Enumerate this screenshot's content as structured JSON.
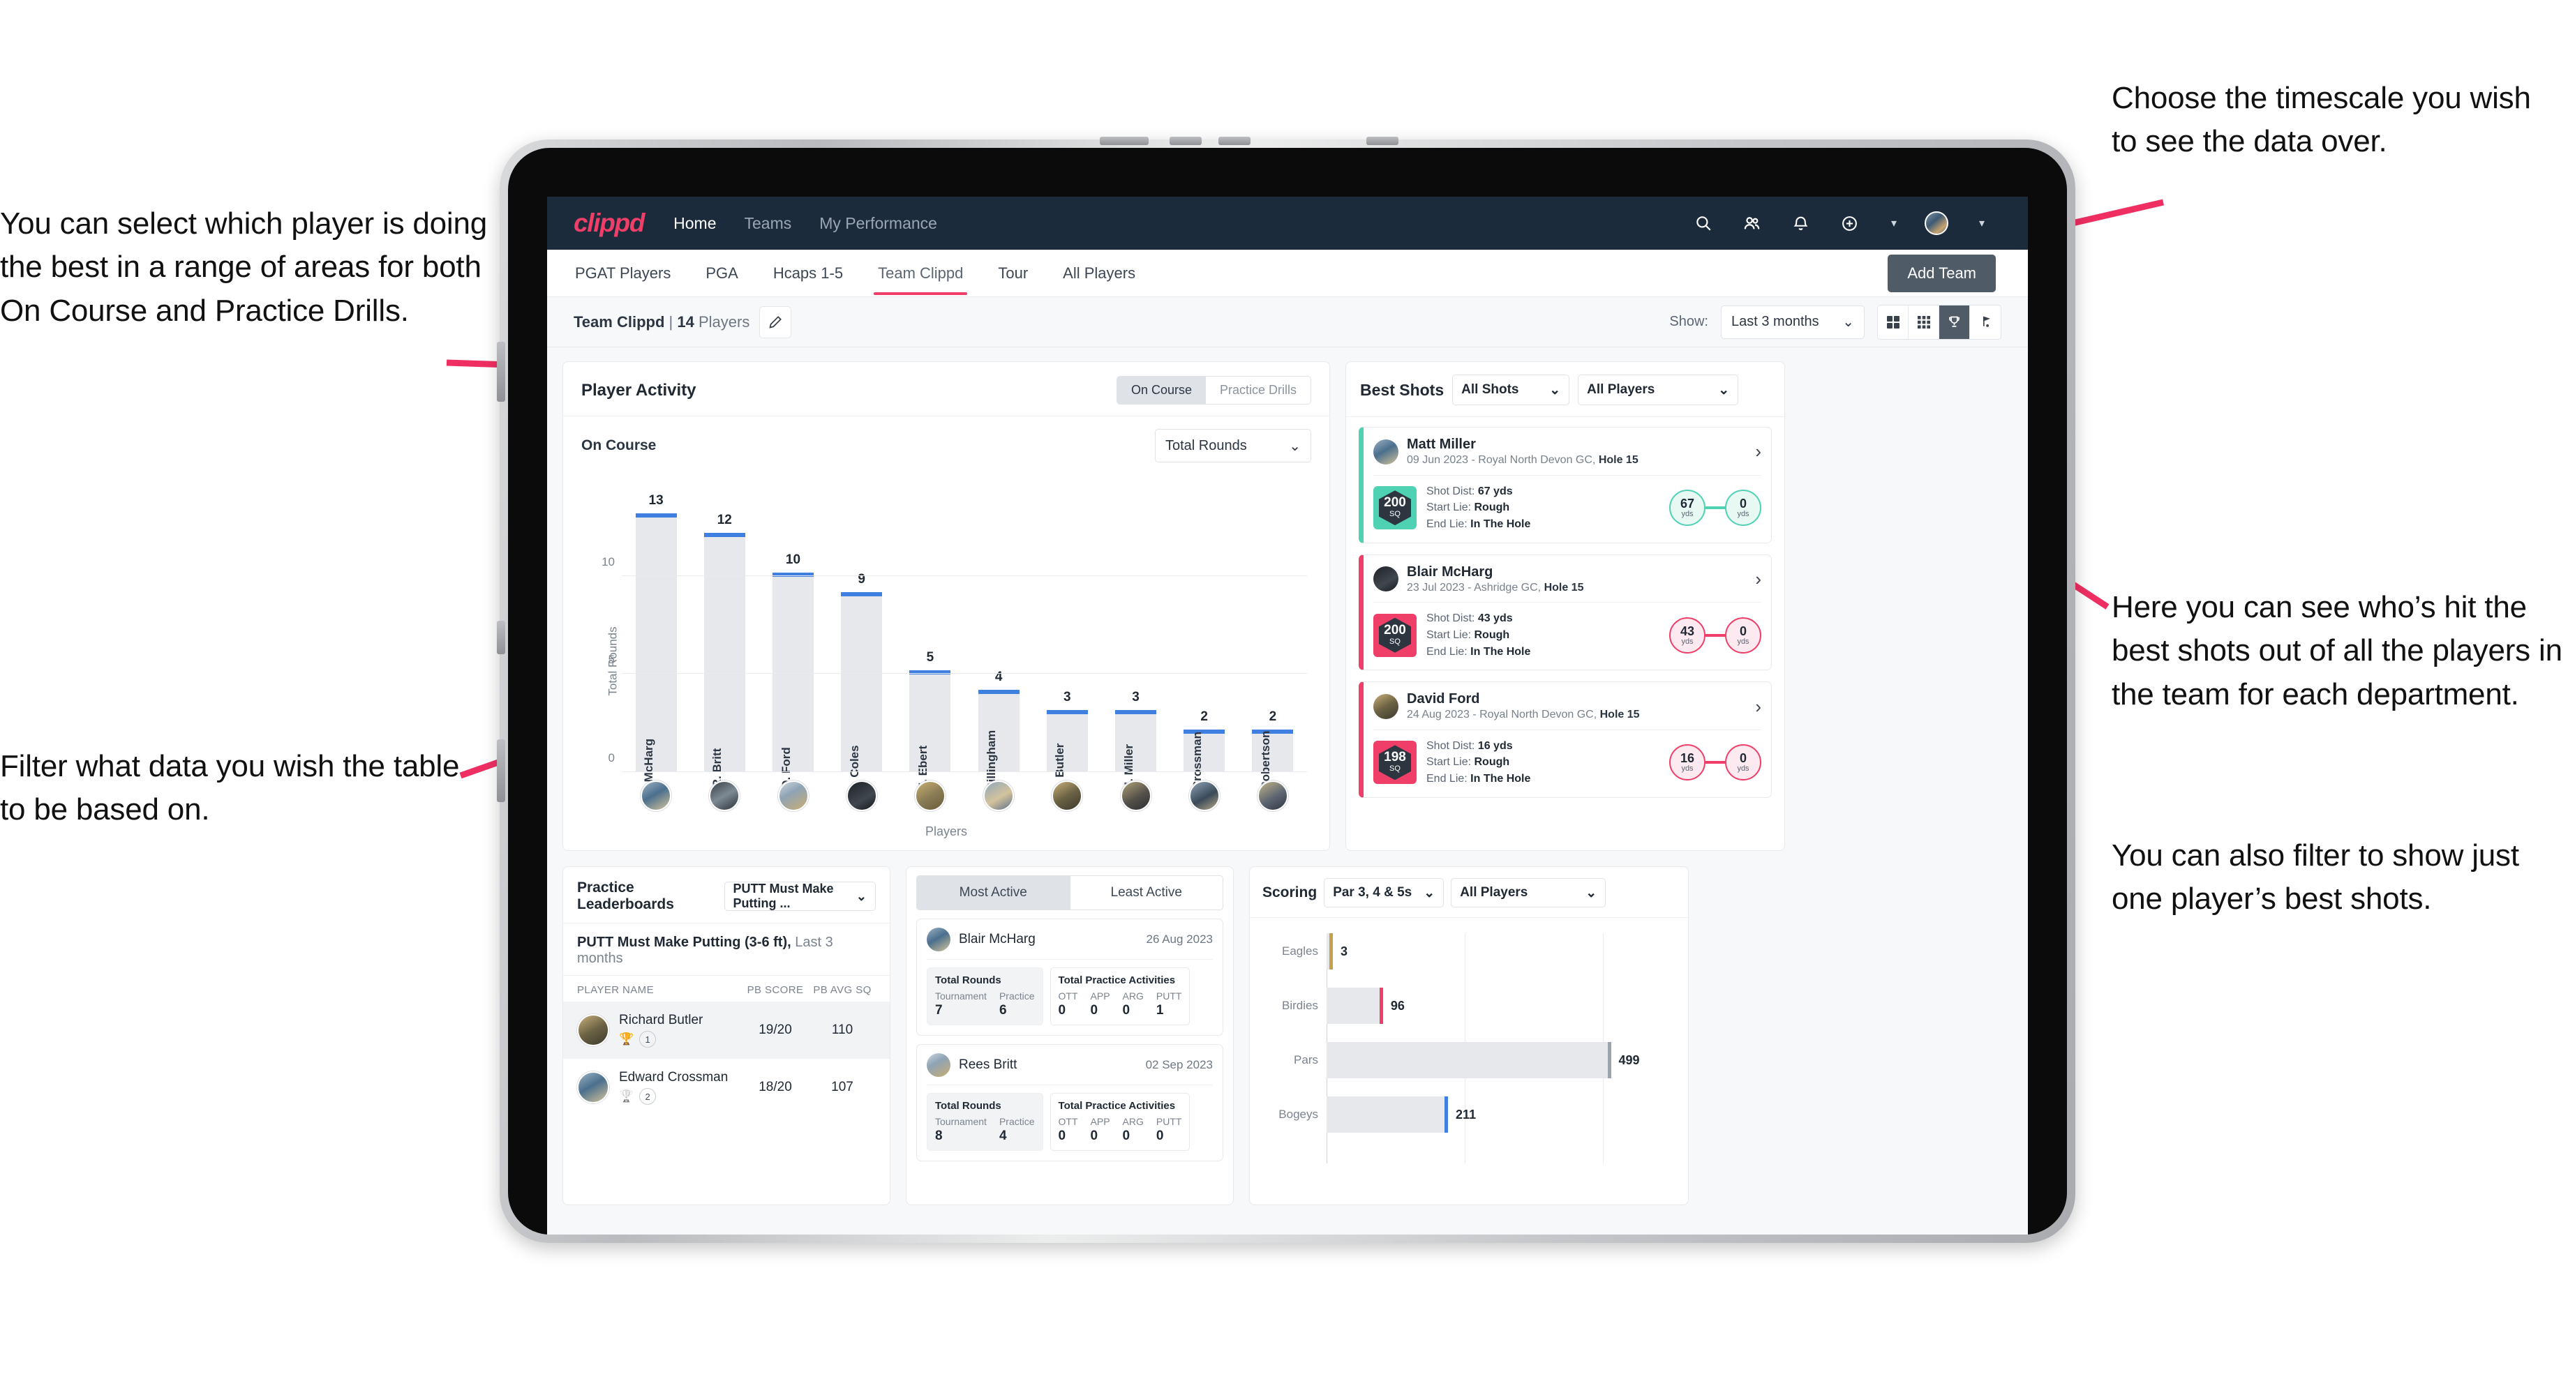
{
  "annotations": {
    "left_top": "You can select which player is doing the best in a range of areas for both On Course and Practice Drills.",
    "left_bottom": "Filter what data you wish the table to be based on.",
    "right_top": "Choose the timescale you wish to see the data over.",
    "right_mid": "Here you can see who’s hit the best shots out of all the players in the team for each department.",
    "right_bottom": "You can also filter to show just one player’s best shots."
  },
  "colors": {
    "brand_pink": "#ef3e68",
    "navbar": "#1b2b3b",
    "bar_blue": "#3f7fe0",
    "teal": "#4fd1b3",
    "gold": "#c4a14a",
    "arrow": "#ef2f62"
  },
  "navbar": {
    "logo": "clippd",
    "links": [
      {
        "label": "Home",
        "active": true
      },
      {
        "label": "Teams",
        "active": false
      },
      {
        "label": "My Performance",
        "active": false
      }
    ],
    "icons": [
      "search-icon",
      "people-icon",
      "bell-icon",
      "plus-circle-icon",
      "avatar"
    ]
  },
  "tabs": [
    {
      "label": "PGAT Players",
      "active": false
    },
    {
      "label": "PGA",
      "active": false
    },
    {
      "label": "Hcaps 1-5",
      "active": false
    },
    {
      "label": "Team Clippd",
      "active": true
    },
    {
      "label": "Tour",
      "active": false
    },
    {
      "label": "All Players",
      "active": false
    }
  ],
  "add_team_label": "Add Team",
  "subheader": {
    "team_name": "Team Clippd",
    "separator": "|",
    "player_count": "14",
    "players_word": "Players",
    "show_label": "Show:",
    "show_value": "Last 3 months",
    "view_buttons": [
      "grid-2x2-icon",
      "grid-3x3-icon",
      "trophy-icon",
      "golf-flag-icon"
    ],
    "active_view_index": 2
  },
  "player_activity": {
    "title": "Player Activity",
    "segments": [
      {
        "label": "On Course",
        "active": true
      },
      {
        "label": "Practice Drills",
        "active": false
      }
    ],
    "sub_title": "On Course",
    "metric_select": "Total Rounds"
  },
  "chart_data": [
    {
      "id": "player-activity",
      "type": "bar",
      "title": "Player Activity - On Course",
      "xlabel": "Players",
      "ylabel": "Total Rounds",
      "ylim": [
        0,
        14
      ],
      "yticks": [
        0,
        5,
        10
      ],
      "grid": true,
      "categories": [
        "B. McHarg",
        "R. Britt",
        "D. Ford",
        "J. Coles",
        "E. Ebert",
        "D. Billingham",
        "R. Butler",
        "M. Miller",
        "E. Crossman",
        "C. Robertson"
      ],
      "values": [
        13,
        12,
        10,
        9,
        5,
        4,
        3,
        3,
        2,
        2
      ]
    },
    {
      "id": "scoring",
      "type": "bar",
      "orientation": "horizontal",
      "title": "Scoring",
      "categories": [
        "Eagles",
        "Birdies",
        "Pars",
        "Bogeys"
      ],
      "values": [
        3,
        96,
        499,
        211
      ],
      "xlim": [
        0,
        560
      ],
      "grid": true,
      "cap_colors": [
        "#c4a14a",
        "#ef3e68",
        "#9ba3ad",
        "#3f7fe0"
      ]
    }
  ],
  "best_shots": {
    "title": "Best Shots",
    "shot_filter": "All Shots",
    "player_filter": "All Players",
    "items": [
      {
        "name": "Matt Miller",
        "meta_prefix": "09 Jun 2023 - Royal North Devon GC,",
        "hole": "Hole 15",
        "badge_value": "200",
        "badge_unit": "SQ",
        "accent": "#4fd1b3",
        "shot_dist_label": "Shot Dist:",
        "shot_dist": "67 yds",
        "start_lie_label": "Start Lie:",
        "start_lie": "Rough",
        "end_lie_label": "End Lie:",
        "end_lie": "In The Hole",
        "from_value": "67",
        "from_unit": "yds",
        "to_value": "0",
        "to_unit": "yds"
      },
      {
        "name": "Blair McHarg",
        "meta_prefix": "23 Jul 2023 - Ashridge GC,",
        "hole": "Hole 15",
        "badge_value": "200",
        "badge_unit": "SQ",
        "accent": "#ef3e68",
        "shot_dist_label": "Shot Dist:",
        "shot_dist": "43 yds",
        "start_lie_label": "Start Lie:",
        "start_lie": "Rough",
        "end_lie_label": "End Lie:",
        "end_lie": "In The Hole",
        "from_value": "43",
        "from_unit": "yds",
        "to_value": "0",
        "to_unit": "yds"
      },
      {
        "name": "David Ford",
        "meta_prefix": "24 Aug 2023 - Royal North Devon GC,",
        "hole": "Hole 15",
        "badge_value": "198",
        "badge_unit": "SQ",
        "accent": "#ef3e68",
        "shot_dist_label": "Shot Dist:",
        "shot_dist": "16 yds",
        "start_lie_label": "Start Lie:",
        "start_lie": "Rough",
        "end_lie_label": "End Lie:",
        "end_lie": "In The Hole",
        "from_value": "16",
        "from_unit": "yds",
        "to_value": "0",
        "to_unit": "yds"
      }
    ]
  },
  "practice_leaderboards": {
    "title": "Practice Leaderboards",
    "drill_select": "PUTT Must Make Putting ...",
    "sub_bold": "PUTT Must Make Putting (3-6 ft),",
    "sub_gray": "Last 3 months",
    "columns": [
      "PLAYER NAME",
      "PB SCORE",
      "PB AVG SQ"
    ],
    "rows": [
      {
        "name": "Richard Butler",
        "rank": "1",
        "trophy": "gold",
        "pb_score": "19/20",
        "pb_avg_sq": "110",
        "highlight": true
      },
      {
        "name": "Edward Crossman",
        "rank": "2",
        "trophy": "silver",
        "pb_score": "18/20",
        "pb_avg_sq": "107",
        "highlight": false
      }
    ]
  },
  "activity": {
    "tabs": [
      {
        "label": "Most Active",
        "active": true
      },
      {
        "label": "Least Active",
        "active": false
      }
    ],
    "items": [
      {
        "name": "Blair McHarg",
        "date": "26 Aug 2023",
        "rounds_title": "Total Rounds",
        "rounds_cols": [
          "Tournament",
          "Practice"
        ],
        "rounds_vals": [
          "7",
          "6"
        ],
        "practice_title": "Total Practice Activities",
        "practice_cols": [
          "OTT",
          "APP",
          "ARG",
          "PUTT"
        ],
        "practice_vals": [
          "0",
          "0",
          "0",
          "1"
        ]
      },
      {
        "name": "Rees Britt",
        "date": "02 Sep 2023",
        "rounds_title": "Total Rounds",
        "rounds_cols": [
          "Tournament",
          "Practice"
        ],
        "rounds_vals": [
          "8",
          "4"
        ],
        "practice_title": "Total Practice Activities",
        "practice_cols": [
          "OTT",
          "APP",
          "ARG",
          "PUTT"
        ],
        "practice_vals": [
          "0",
          "0",
          "0",
          "0"
        ]
      }
    ]
  },
  "scoring": {
    "title": "Scoring",
    "par_filter": "Par 3, 4 & 5s",
    "player_filter": "All Players"
  }
}
